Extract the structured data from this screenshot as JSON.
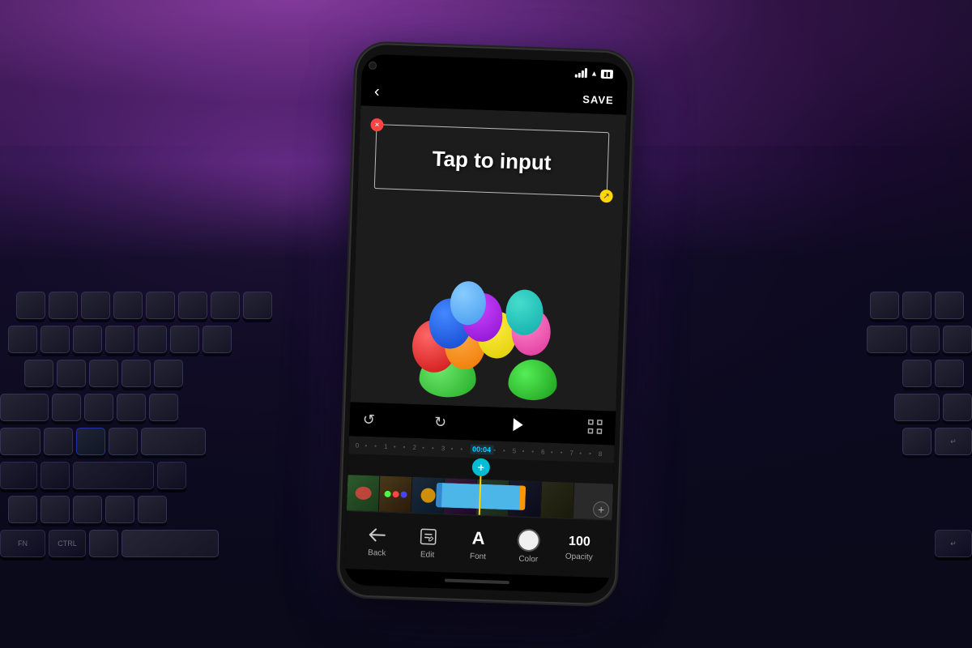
{
  "scene": {
    "bg_color": "#1a0a2e"
  },
  "phone": {
    "top_nav": {
      "back_icon": "‹",
      "save_label": "SAVE"
    },
    "video_preview": {
      "tap_text": "Tap to input",
      "handle_close": "×",
      "handle_resize": "↗"
    },
    "controls": {
      "undo_icon": "↺",
      "redo_icon": "↻",
      "play_icon": "▶",
      "fullscreen_icon": "⛶"
    },
    "timeline": {
      "marks": [
        "0",
        "•",
        "•",
        "1",
        "•",
        "•",
        "2",
        "•",
        "•",
        "3",
        "•",
        "•",
        "00:04",
        "•",
        "•",
        "5",
        "•",
        "•",
        "6",
        "•",
        "•",
        "7",
        "•",
        "•",
        "8"
      ],
      "current_time": "00:04"
    },
    "bottom_toolbar": {
      "items": [
        {
          "id": "back",
          "label": "Back",
          "icon": "←"
        },
        {
          "id": "edit",
          "label": "Edit",
          "icon": "✎"
        },
        {
          "id": "font",
          "label": "Font",
          "icon": "A"
        },
        {
          "id": "color",
          "label": "Color",
          "icon": "circle"
        },
        {
          "id": "opacity",
          "label": "Opacity",
          "value": "100"
        }
      ]
    }
  }
}
